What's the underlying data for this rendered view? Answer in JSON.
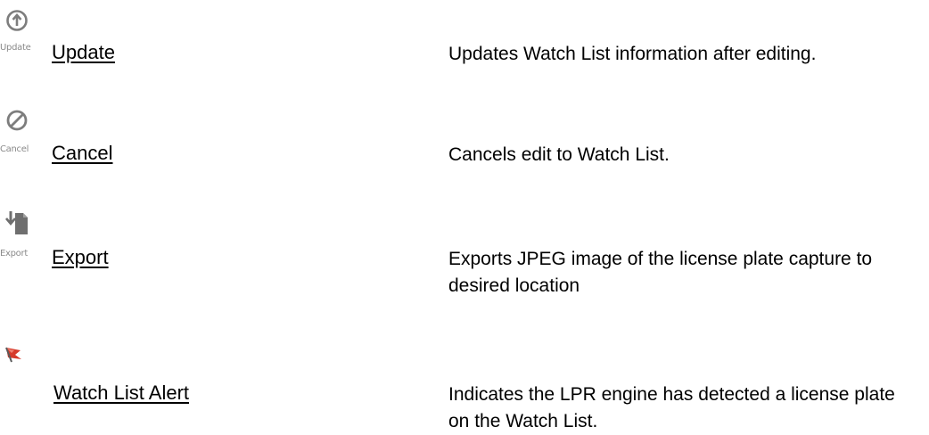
{
  "rows": [
    {
      "icon": "update-arrow-up-circle-icon",
      "icon_caption": "Update",
      "label": "Update",
      "description": "Updates Watch List information after editing."
    },
    {
      "icon": "cancel-slashed-circle-icon",
      "icon_caption": "Cancel",
      "label": "Cancel",
      "description": "Cancels edit to Watch List."
    },
    {
      "icon": "export-document-arrow-icon",
      "icon_caption": "Export",
      "label": "Export",
      "description": "Exports JPEG image of the license plate capture to desired location"
    },
    {
      "icon": "watch-list-alert-flag-icon",
      "icon_caption": "",
      "label": "Watch List Alert",
      "description": "Indicates the LPR engine has detected a license plate on the Watch List."
    }
  ],
  "colors": {
    "icon_gray": "#7d7d7d",
    "caption_gray": "#8a8a8a",
    "alert_red": "#d63a2a",
    "text": "#000000"
  }
}
